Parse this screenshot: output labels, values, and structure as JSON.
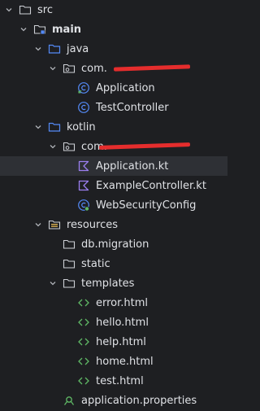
{
  "tree": [
    {
      "label": "src"
    },
    {
      "label": "main"
    },
    {
      "label": "java"
    },
    {
      "label": "com."
    },
    {
      "label": "Application"
    },
    {
      "label": "TestController"
    },
    {
      "label": "kotlin"
    },
    {
      "label": "com."
    },
    {
      "label": "Application.kt"
    },
    {
      "label": "ExampleController.kt"
    },
    {
      "label": "WebSecurityConfig"
    },
    {
      "label": "resources"
    },
    {
      "label": "db.migration"
    },
    {
      "label": "static"
    },
    {
      "label": "templates"
    },
    {
      "label": "error.html"
    },
    {
      "label": "hello.html"
    },
    {
      "label": "help.html"
    },
    {
      "label": "home.html"
    },
    {
      "label": "test.html"
    },
    {
      "label": "application.properties"
    }
  ],
  "colors": {
    "background": "#1e1f22",
    "selected_row": "#2e3035",
    "folder": "#ced0d6",
    "source_folder": "#548af7",
    "class_icon": "#548af7",
    "kotlin_icon": "#9b7ff0",
    "html_icon": "#5fb865",
    "properties_icon": "#5fb865",
    "redaction": "#e52d2d"
  }
}
